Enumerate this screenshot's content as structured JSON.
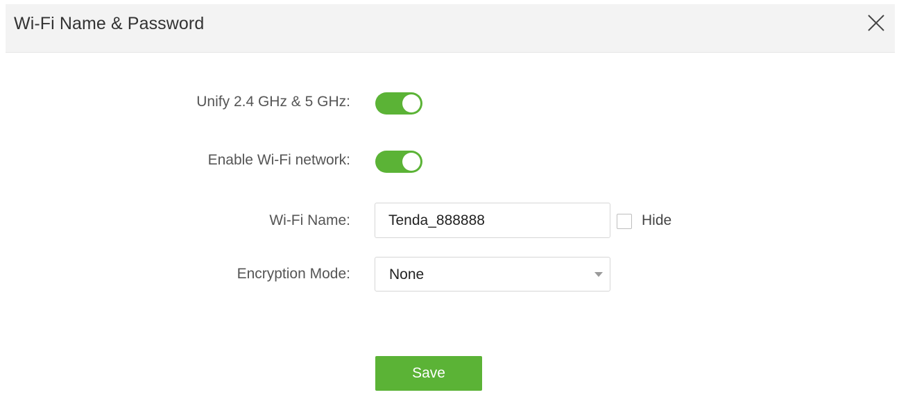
{
  "dialog": {
    "title": "Wi-Fi Name & Password",
    "close_icon": "close-icon"
  },
  "form": {
    "unify": {
      "label": "Unify 2.4 GHz & 5 GHz:",
      "enabled": true
    },
    "enable_wifi": {
      "label": "Enable Wi-Fi network:",
      "enabled": true
    },
    "wifi_name": {
      "label": "Wi-Fi Name:",
      "value": "Tenda_888888",
      "hide_label": "Hide",
      "hide_checked": false
    },
    "encryption": {
      "label": "Encryption Mode:",
      "selected": "None",
      "arrow_icon": "caret-down-icon"
    },
    "save_label": "Save"
  },
  "colors": {
    "accent": "#5bb336",
    "header_bg": "#f3f3f3"
  }
}
